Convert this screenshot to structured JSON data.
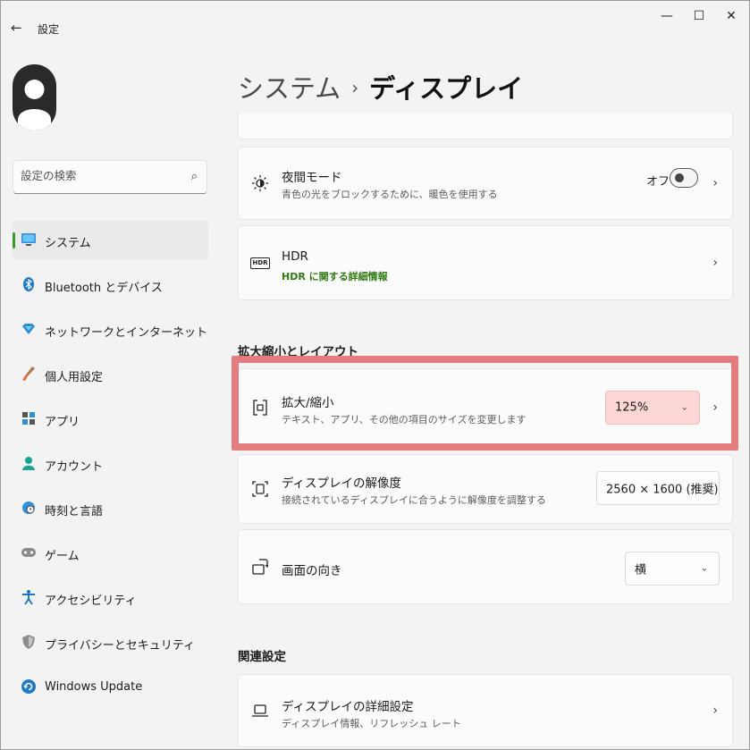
{
  "window": {
    "title": "設定",
    "back_icon": "←",
    "minimize": "—",
    "maximize": "☐",
    "close": "✕"
  },
  "search": {
    "placeholder": "設定の検索"
  },
  "sidebar": {
    "items": [
      {
        "label": "システム",
        "icon": "monitor-icon",
        "active": true
      },
      {
        "label": "Bluetooth とデバイス",
        "icon": "bluetooth-icon"
      },
      {
        "label": "ネットワークとインターネット",
        "icon": "wifi-diamond-icon"
      },
      {
        "label": "個人用設定",
        "icon": "brush-icon"
      },
      {
        "label": "アプリ",
        "icon": "apps-icon"
      },
      {
        "label": "アカウント",
        "icon": "account-icon"
      },
      {
        "label": "時刻と言語",
        "icon": "globe-clock-icon"
      },
      {
        "label": "ゲーム",
        "icon": "gamepad-icon"
      },
      {
        "label": "アクセシビリティ",
        "icon": "accessibility-icon"
      },
      {
        "label": "プライバシーとセキュリティ",
        "icon": "shield-icon"
      },
      {
        "label": "Windows Update",
        "icon": "update-icon"
      }
    ]
  },
  "breadcrumb": {
    "parent": "システム",
    "separator": "›",
    "current": "ディスプレイ"
  },
  "cards": {
    "night_light": {
      "title": "夜間モード",
      "subtitle": "青色の光をブロックするために、暖色を使用する",
      "toggle_label": "オフ",
      "toggle_on": false
    },
    "hdr": {
      "title": "HDR",
      "subtitle": "HDR に関する詳細情報",
      "icon_text": "HDR"
    },
    "scale": {
      "title": "拡大/縮小",
      "subtitle": "テキスト、アプリ、その他の項目のサイズを変更します",
      "value": "125%"
    },
    "resolution": {
      "title": "ディスプレイの解像度",
      "subtitle": "接続されているディスプレイに合うように解像度を調整する",
      "value": "2560 × 1600 (推奨)"
    },
    "orientation": {
      "title": "画面の向き",
      "value": "横"
    },
    "advanced": {
      "title": "ディスプレイの詳細設定",
      "subtitle": "ディスプレイ情報、リフレッシュ レート"
    }
  },
  "sections": {
    "scale_layout": "拡大縮小とレイアウト",
    "related": "関連設定"
  },
  "colors": {
    "accent": "#3a9a2a",
    "link_green": "#2f7a12",
    "highlight": "#e37c7c",
    "scale_dropdown_bg": "#fcd5d5"
  }
}
